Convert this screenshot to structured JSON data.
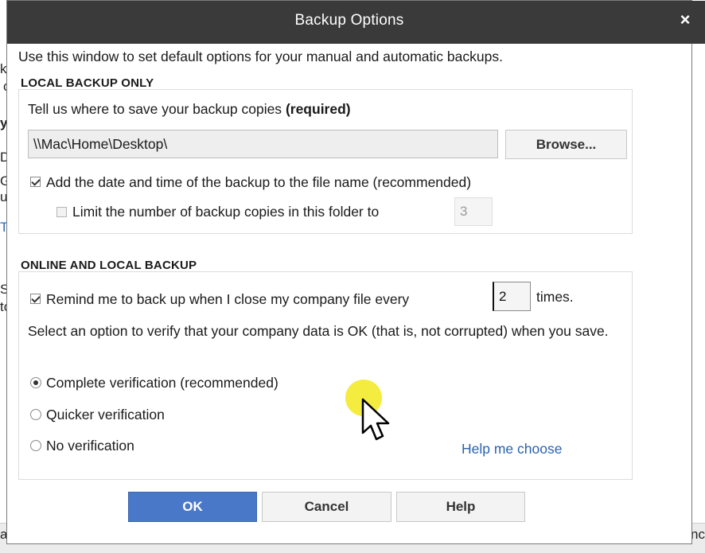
{
  "window": {
    "title": "Backup Options",
    "close_label": "×"
  },
  "intro": "Use this window to set default options for your manual and automatic backups.",
  "local": {
    "heading": "LOCAL BACKUP ONLY",
    "location_label": "Tell us where to save your backup copies",
    "location_required": "(required)",
    "path_value": "\\\\Mac\\Home\\Desktop\\",
    "browse_label": "Browse...",
    "add_date_label": "Add the date and time of the backup to the file name (recommended)",
    "add_date_checked": true,
    "limit_label": "Limit the number of backup copies in this folder to",
    "limit_checked": false,
    "limit_value": "3"
  },
  "online": {
    "heading": "ONLINE AND LOCAL BACKUP",
    "remind_label": "Remind me to back up when I close my company file every",
    "remind_checked": true,
    "remind_value": "2",
    "remind_suffix": "times.",
    "verify_text": "Select an option to verify that your company data is OK (that is, not corrupted) when you save.",
    "options": [
      {
        "label": "Complete verification (recommended)",
        "selected": true
      },
      {
        "label": "Quicker verification",
        "selected": false
      },
      {
        "label": "No verification",
        "selected": false
      }
    ],
    "help_link": "Help me choose"
  },
  "buttons": {
    "ok": "OK",
    "cancel": "Cancel",
    "help": "Help"
  },
  "background": {
    "fragments": [
      "ke",
      "c",
      "y",
      "Dr",
      "G",
      "u",
      "T",
      "S",
      "to"
    ],
    "bottom_left": "ac",
    "bottom_right": "nc"
  },
  "colors": {
    "titlebar": "#3a3a3a",
    "ok_button": "#4a78c8",
    "link": "#2a62b0",
    "cursor_highlight": "#f3ea2a"
  }
}
